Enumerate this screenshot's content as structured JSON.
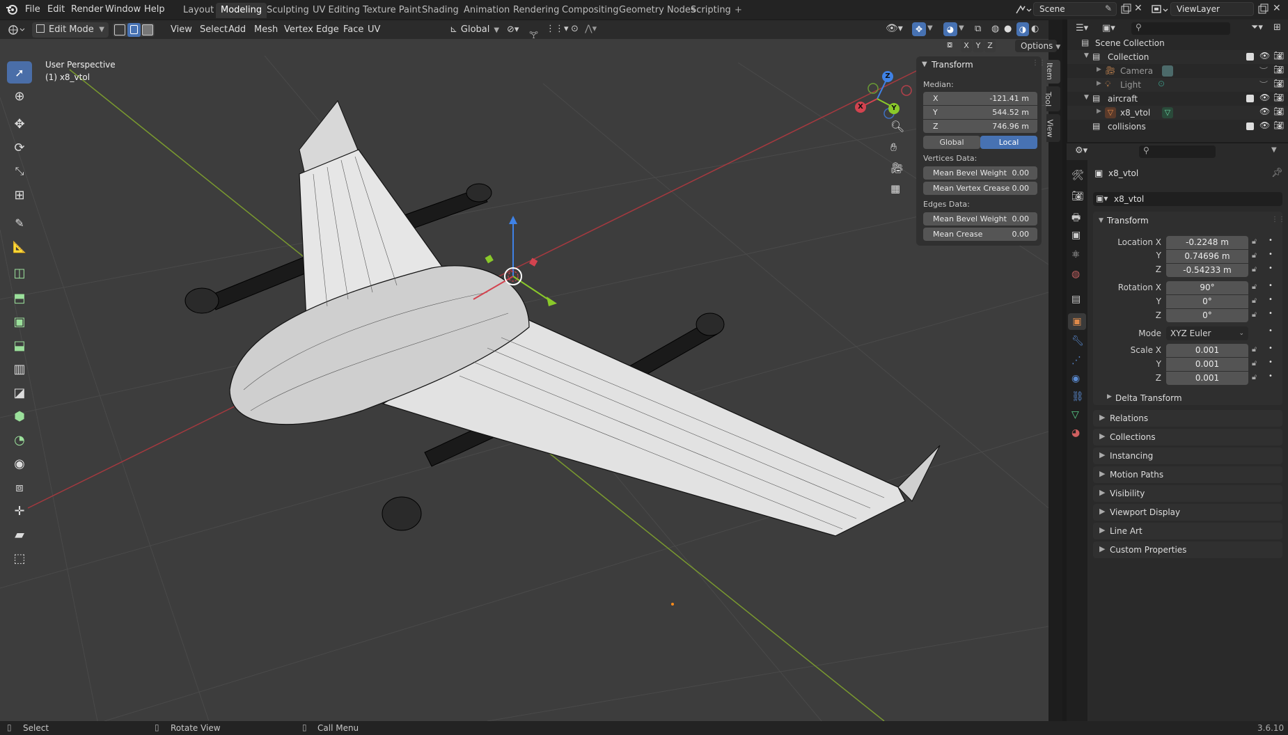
{
  "topbar": {
    "menus": [
      "File",
      "Edit",
      "Render",
      "Window",
      "Help"
    ],
    "workspaces": [
      "Layout",
      "Modeling",
      "Sculpting",
      "UV Editing",
      "Texture Paint",
      "Shading",
      "Animation",
      "Rendering",
      "Compositing",
      "Geometry Nodes",
      "Scripting"
    ],
    "active_workspace": "Modeling",
    "add_tab": "+",
    "scene": "Scene",
    "view_layer": "ViewLayer"
  },
  "viewport_header": {
    "mode": "Edit Mode",
    "menus": [
      "View",
      "Select",
      "Add",
      "Mesh",
      "Vertex",
      "Edge",
      "Face",
      "UV"
    ],
    "orientation": "Global",
    "options": "Options",
    "axes": [
      "X",
      "Y",
      "Z"
    ]
  },
  "viewport": {
    "view_name": "User Perspective",
    "object_info": "(1) x8_vtol",
    "gizmo_axes": [
      "X",
      "Y",
      "Z"
    ]
  },
  "npanel": {
    "title": "Transform",
    "median_label": "Median:",
    "median": [
      {
        "axis": "X",
        "value": "-121.41 m"
      },
      {
        "axis": "Y",
        "value": "544.52 m"
      },
      {
        "axis": "Z",
        "value": "746.96 m"
      }
    ],
    "toggle_global": "Global",
    "toggle_local": "Local",
    "vertices_label": "Vertices Data:",
    "vertices": [
      {
        "label": "Mean Bevel Weight",
        "value": "0.00"
      },
      {
        "label": "Mean Vertex Crease",
        "value": "0.00"
      }
    ],
    "edges_label": "Edges Data:",
    "edges": [
      {
        "label": "Mean Bevel Weight",
        "value": "0.00"
      },
      {
        "label": "Mean Crease",
        "value": "0.00"
      }
    ],
    "side_tabs": [
      "Item",
      "Tool",
      "View"
    ]
  },
  "outliner": {
    "rows": [
      {
        "label": "Scene Collection"
      },
      {
        "label": "Collection"
      },
      {
        "label": "Camera"
      },
      {
        "label": "Light"
      },
      {
        "label": "aircraft"
      },
      {
        "label": "x8_vtol"
      },
      {
        "label": "collisions"
      }
    ]
  },
  "properties": {
    "object_name": "x8_vtol",
    "name_field": "x8_vtol",
    "transform_title": "Transform",
    "location": {
      "label_x": "Location X",
      "x": "-0.2248 m",
      "y": "0.74696 m",
      "z": "-0.54233 m"
    },
    "rotation": {
      "label_x": "Rotation X",
      "x": "90°",
      "y": "0°",
      "z": "0°"
    },
    "mode_label": "Mode",
    "mode_value": "XYZ Euler",
    "scale": {
      "label_x": "Scale X",
      "x": "0.001",
      "y": "0.001",
      "z": "0.001"
    },
    "axis_y": "Y",
    "axis_z": "Z",
    "delta_transform": "Delta Transform",
    "panels": [
      "Relations",
      "Collections",
      "Instancing",
      "Motion Paths",
      "Visibility",
      "Viewport Display",
      "Line Art",
      "Custom Properties"
    ]
  },
  "statusbar": {
    "select": "Select",
    "rotate": "Rotate View",
    "call_menu": "Call Menu",
    "version": "3.6.10"
  },
  "colors": {
    "accent": "#4772b3",
    "x_axis": "#d3434f",
    "y_axis": "#8ac92a",
    "z_axis": "#3f82e6",
    "viewport_bg": "#3d3d3d"
  }
}
